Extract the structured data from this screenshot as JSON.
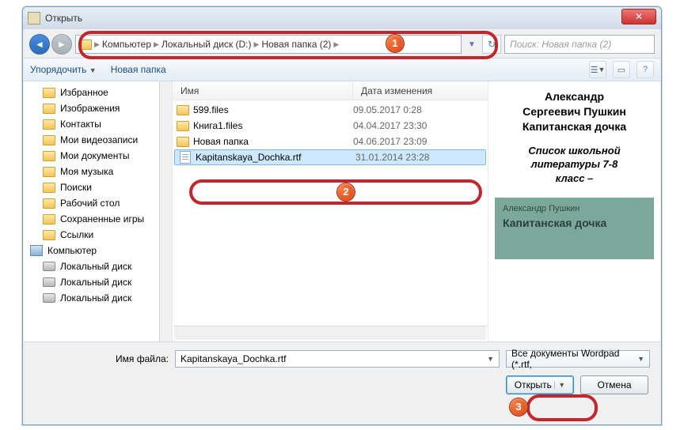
{
  "window": {
    "title": "Открыть"
  },
  "nav": {
    "breadcrumb": [
      "Компьютер",
      "Локальный диск (D:)",
      "Новая папка (2)"
    ],
    "search_placeholder": "Поиск: Новая папка (2)"
  },
  "toolbar": {
    "organize": "Упорядочить",
    "newfolder": "Новая папка"
  },
  "sidebar": {
    "items": [
      {
        "label": "Избранное"
      },
      {
        "label": "Изображения"
      },
      {
        "label": "Контакты"
      },
      {
        "label": "Мои видеозаписи"
      },
      {
        "label": "Мои документы"
      },
      {
        "label": "Моя музыка"
      },
      {
        "label": "Поиски"
      },
      {
        "label": "Рабочий стол"
      },
      {
        "label": "Сохраненные игры"
      },
      {
        "label": "Ссылки"
      }
    ],
    "computer": "Компьютер",
    "disks": [
      "Локальный диск",
      "Локальный диск",
      "Локальный диск"
    ]
  },
  "fileheader": {
    "name": "Имя",
    "date": "Дата изменения"
  },
  "files": [
    {
      "name": "599.files",
      "date": "09.05.2017 0:28",
      "type": "folder"
    },
    {
      "name": "Книга1.files",
      "date": "04.04.2017 23:30",
      "type": "folder"
    },
    {
      "name": "Новая папка",
      "date": "04.06.2017 23:09",
      "type": "folder"
    },
    {
      "name": "Kapitanskaya_Dochka.rtf",
      "date": "31.01.2014 23:28",
      "type": "rtf",
      "selected": true
    }
  ],
  "preview": {
    "title_lines": [
      "Александр",
      "Сергеевич Пушкин",
      "Капитанская дочка"
    ],
    "subtitle_lines": [
      "Список школьной",
      "литературы 7-8",
      "класс –"
    ],
    "cover_author": "Александр Пушкин",
    "cover_title": "Капитанская дочка"
  },
  "filename_label": "Имя файла:",
  "filename_value": "Kapitanskaya_Dochka.rtf",
  "filter_label": "Все документы Wordpad (*.rtf,",
  "buttons": {
    "open": "Открыть",
    "cancel": "Отмена"
  },
  "badges": {
    "b1": "1",
    "b2": "2",
    "b3": "3"
  }
}
